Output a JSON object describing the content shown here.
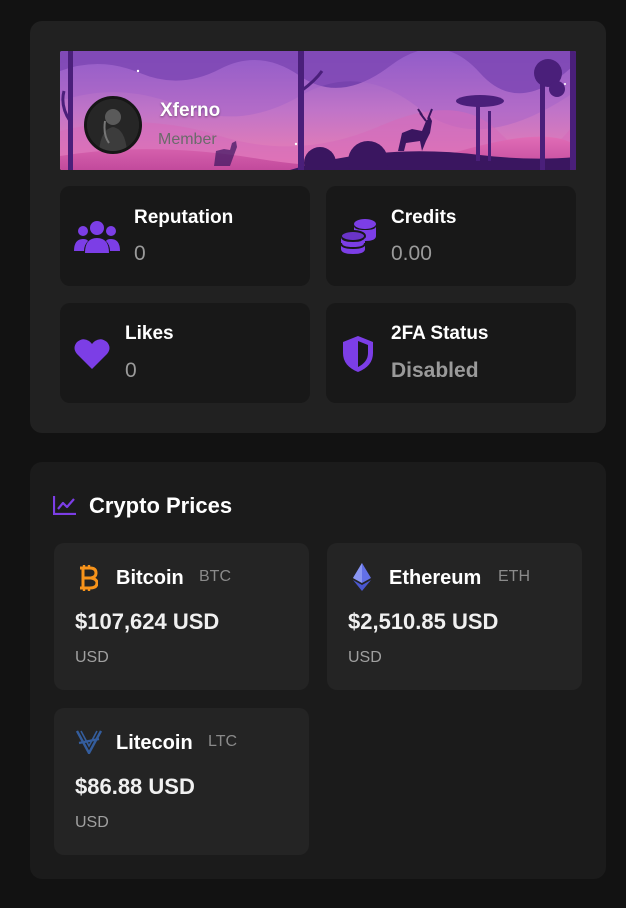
{
  "profile": {
    "username": "Xferno",
    "role": "Member",
    "stats": {
      "reputation": {
        "title": "Reputation",
        "value": "0",
        "icon": "users-icon"
      },
      "credits": {
        "title": "Credits",
        "value": "0.00",
        "icon": "coins-icon"
      },
      "likes": {
        "title": "Likes",
        "value": "0",
        "icon": "heart-icon"
      },
      "twofa": {
        "title": "2FA Status",
        "value": "Disabled",
        "icon": "shield-icon"
      }
    }
  },
  "crypto": {
    "title": "Crypto Prices",
    "icon": "chart-line-icon",
    "coins": [
      {
        "name": "Bitcoin",
        "symbol": "BTC",
        "price": "$107,624 USD",
        "currency": "USD",
        "icon": "bitcoin-icon",
        "color": "#f7931a"
      },
      {
        "name": "Ethereum",
        "symbol": "ETH",
        "price": "$2,510.85 USD",
        "currency": "USD",
        "icon": "ethereum-icon",
        "color": "#6270e8"
      },
      {
        "name": "Litecoin",
        "symbol": "LTC",
        "price": "$86.88 USD",
        "currency": "USD",
        "icon": "litecoin-icon",
        "color": "#345d9d"
      }
    ]
  },
  "colors": {
    "accent": "#7c3ee6",
    "card_bg": "#212121",
    "page_bg": "#121212"
  }
}
